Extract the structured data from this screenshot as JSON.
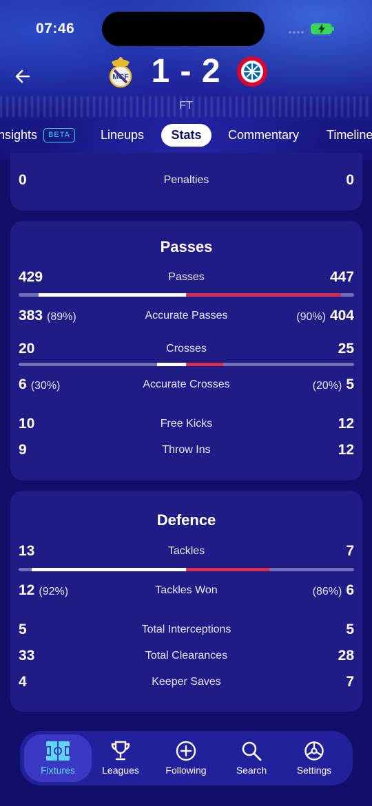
{
  "status_bar": {
    "time": "07:46"
  },
  "match": {
    "home_score": "1",
    "separator": "-",
    "away_score": "2",
    "status": "FT"
  },
  "tabs": [
    {
      "label": "Insights",
      "badge": "BETA"
    },
    {
      "label": "Lineups"
    },
    {
      "label": "Stats",
      "selected": true
    },
    {
      "label": "Commentary"
    },
    {
      "label": "Timeline"
    }
  ],
  "top_card": {
    "home": "0",
    "label": "Penalties",
    "away": "0"
  },
  "passes": {
    "title": "Passes",
    "rows": [
      {
        "home": "429",
        "label": "Passes",
        "away": "447",
        "bar_home": 429,
        "bar_away": 447
      },
      {
        "home": "383",
        "home_pct": "(89%)",
        "label": "Accurate Passes",
        "away": "404",
        "away_pct": "(90%)"
      },
      {
        "home": "20",
        "label": "Crosses",
        "away": "25",
        "bar_home": 20,
        "bar_away": 25
      },
      {
        "home": "6",
        "home_pct": "(30%)",
        "label": "Accurate Crosses",
        "away": "5",
        "away_pct": "(20%)"
      },
      {
        "home": "10",
        "label": "Free Kicks",
        "away": "12"
      },
      {
        "home": "9",
        "label": "Throw Ins",
        "away": "12"
      }
    ]
  },
  "defence": {
    "title": "Defence",
    "rows": [
      {
        "home": "13",
        "label": "Tackles",
        "away": "7",
        "bar_home": 13,
        "bar_away": 7
      },
      {
        "home": "12",
        "home_pct": "(92%)",
        "label": "Tackles Won",
        "away": "6",
        "away_pct": "(86%)"
      },
      {
        "home": "5",
        "label": "Total Interceptions",
        "away": "5"
      },
      {
        "home": "33",
        "label": "Total Clearances",
        "away": "28"
      },
      {
        "home": "4",
        "label": "Keeper Saves",
        "away": "7"
      }
    ]
  },
  "bottom_nav": [
    {
      "label": "Fixtures",
      "icon": "pitch-icon",
      "active": true
    },
    {
      "label": "Leagues",
      "icon": "trophy-icon"
    },
    {
      "label": "Following",
      "icon": "plus-circle-icon"
    },
    {
      "label": "Search",
      "icon": "search-icon"
    },
    {
      "label": "Settings",
      "icon": "gear-icon"
    }
  ],
  "colors": {
    "home_bar": "#ffffff",
    "away_bar": "#dc2d50",
    "accent": "#5fd6f0",
    "background": "#120f6a",
    "card": "#201c86"
  }
}
